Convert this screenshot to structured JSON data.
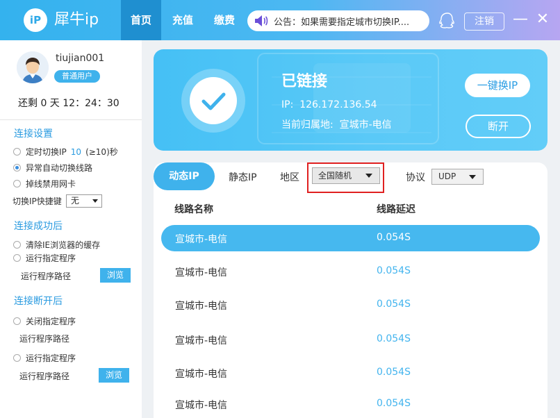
{
  "app": {
    "logo_text": "iP",
    "brand": "犀牛ip"
  },
  "nav": [
    {
      "label": "首页",
      "active": true
    },
    {
      "label": "充值",
      "active": false
    },
    {
      "label": "缴费",
      "active": false
    }
  ],
  "notice": {
    "text": "公告：如果需要指定城市切换IP...."
  },
  "header": {
    "logout_label": "注销",
    "minimize_label": "—",
    "close_label": "✕"
  },
  "user": {
    "name": "tiujian001",
    "badge": "普通用户",
    "remaining": "还剩 0 天 12：24：30"
  },
  "settings": {
    "connect_title": "连接设置",
    "timed_switch_prefix": "定时切换IP",
    "timed_switch_value": "10",
    "timed_switch_suffix": "(≥10)秒",
    "auto_switch_label": "异常自动切换线路",
    "disable_nic_label": "掉线禁用网卡",
    "hotkey_label": "切换IP快捷键",
    "hotkey_value": "无",
    "success_title": "连接成功后",
    "clear_ie_label": "清除IE浏览器的缓存",
    "run_program_label": "运行指定程序",
    "program_path_label": "运行程序路径",
    "browse_label": "浏览",
    "disconnect_title": "连接断开后",
    "close_program_label": "关闭指定程序",
    "program_path_label_2": "运行程序路径",
    "run_program_label_2": "运行指定程序",
    "program_path_label_3": "运行程序路径",
    "browse_label_2": "浏览"
  },
  "status": {
    "title": "已链接",
    "ip_line": "IP:  126.172.136.54",
    "location_line": "当前归属地:  宣城市-电信",
    "switch_button": "一键换IP",
    "disconnect_button": "断开"
  },
  "filters": {
    "tab_dynamic": "动态IP",
    "tab_static": "静态IP",
    "region_label": "地区",
    "region_value": "全国随机",
    "protocol_label": "协议",
    "protocol_value": "UDP"
  },
  "table": {
    "headers": [
      "线路名称",
      "线路延迟"
    ],
    "rows": [
      {
        "name": "宣城市-电信",
        "latency": "0.054S",
        "selected": true
      },
      {
        "name": "宣城市-电信",
        "latency": "0.054S",
        "selected": false
      },
      {
        "name": "宣城市-电信",
        "latency": "0.054S",
        "selected": false
      },
      {
        "name": "宣城市-电信",
        "latency": "0.054S",
        "selected": false
      },
      {
        "name": "宣城市-电信",
        "latency": "0.054S",
        "selected": false
      },
      {
        "name": "宣城市-电信",
        "latency": "0.054S",
        "selected": false
      }
    ]
  },
  "colors": {
    "primary": "#3fb2ec",
    "highlight_border": "#e02020",
    "nav_active": "#1f8fd0"
  },
  "icons": [
    "logo-icon",
    "speaker-icon",
    "qq-icon",
    "minimize-icon",
    "close-icon",
    "avatar",
    "check-icon"
  ]
}
